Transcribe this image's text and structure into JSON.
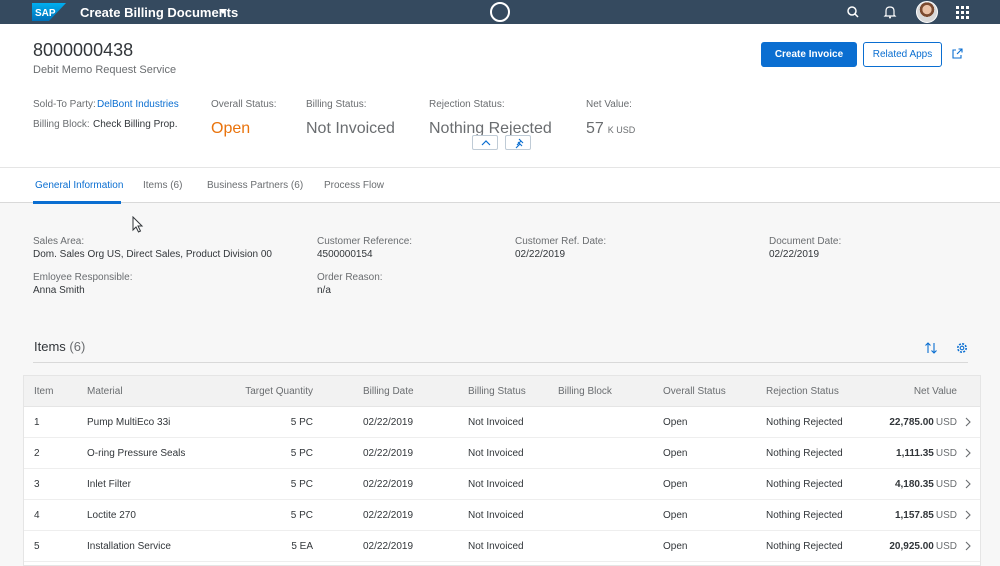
{
  "shell": {
    "logo_text": "SAP",
    "app_title": "Create Billing Documents"
  },
  "header": {
    "title": "8000000438",
    "subtitle": "Debit Memo Request Service",
    "actions": {
      "create_invoice": "Create Invoice",
      "related_apps": "Related Apps"
    },
    "attributes": {
      "sold_to_label": "Sold-To Party:",
      "sold_to_value": "DelBont Industries",
      "billing_block_label": "Billing Block:",
      "billing_block_value": "Check Billing Prop."
    },
    "kpis": {
      "overall_status_label": "Overall Status:",
      "overall_status_value": "Open",
      "billing_status_label": "Billing Status:",
      "billing_status_value": "Not Invoiced",
      "rejection_status_label": "Rejection Status:",
      "rejection_status_value": "Nothing Rejected",
      "net_value_label": "Net Value:",
      "net_value_number": "57",
      "net_value_unit": "K USD"
    }
  },
  "tabs": [
    {
      "label": "General Information"
    },
    {
      "label": "Items (6)"
    },
    {
      "label": "Business Partners (6)"
    },
    {
      "label": "Process Flow"
    }
  ],
  "general": {
    "sales_area_label": "Sales Area:",
    "sales_area_value": "Dom. Sales Org US, Direct Sales, Product Division 00",
    "customer_ref_label": "Customer Reference:",
    "customer_ref_value": "4500000154",
    "customer_ref_date_label": "Customer Ref. Date:",
    "customer_ref_date_value": "02/22/2019",
    "document_date_label": "Document Date:",
    "document_date_value": "02/22/2019",
    "employee_label": "Emloyee Responsible:",
    "employee_value": "Anna Smith",
    "order_reason_label": "Order Reason:",
    "order_reason_value": "n/a"
  },
  "items": {
    "title": "Items",
    "count": "(6)",
    "columns": [
      "Item",
      "Material",
      "Target Quantity",
      "Billing Date",
      "Billing Status",
      "Billing Block",
      "Overall Status",
      "Rejection Status",
      "Net Value"
    ],
    "rows": [
      {
        "item": "1",
        "material": "Pump MultiEco 33i",
        "qty": "5 PC",
        "date": "02/22/2019",
        "billing_status": "Not Invoiced",
        "billing_block": "",
        "overall": "Open",
        "rejection": "Nothing Rejected",
        "net": "22,785.00",
        "currency": "USD"
      },
      {
        "item": "2",
        "material": "O-ring Pressure Seals",
        "qty": "5 PC",
        "date": "02/22/2019",
        "billing_status": "Not Invoiced",
        "billing_block": "",
        "overall": "Open",
        "rejection": "Nothing Rejected",
        "net": "1,111.35",
        "currency": "USD"
      },
      {
        "item": "3",
        "material": "Inlet Filter",
        "qty": "5 PC",
        "date": "02/22/2019",
        "billing_status": "Not Invoiced",
        "billing_block": "",
        "overall": "Open",
        "rejection": "Nothing Rejected",
        "net": "4,180.35",
        "currency": "USD"
      },
      {
        "item": "4",
        "material": "Loctite 270",
        "qty": "5 PC",
        "date": "02/22/2019",
        "billing_status": "Not Invoiced",
        "billing_block": "",
        "overall": "Open",
        "rejection": "Nothing Rejected",
        "net": "1,157.85",
        "currency": "USD"
      },
      {
        "item": "5",
        "material": "Installation Service",
        "qty": "5 EA",
        "date": "02/22/2019",
        "billing_status": "Not Invoiced",
        "billing_block": "",
        "overall": "Open",
        "rejection": "Nothing Rejected",
        "net": "20,925.00",
        "currency": "USD"
      }
    ]
  },
  "colors": {
    "shell": "#354a5f",
    "brand": "#0a6ed1",
    "open_status": "#e9730c"
  },
  "icons": [
    "sap-logo",
    "chevron-down-icon",
    "busy-indicator-icon",
    "search-icon",
    "bell-icon",
    "avatar",
    "grid-icon",
    "share-icon",
    "chevron-up-icon",
    "pin-icon",
    "sort-icon",
    "gear-icon",
    "chevron-right-icon",
    "mouse-cursor-icon"
  ]
}
